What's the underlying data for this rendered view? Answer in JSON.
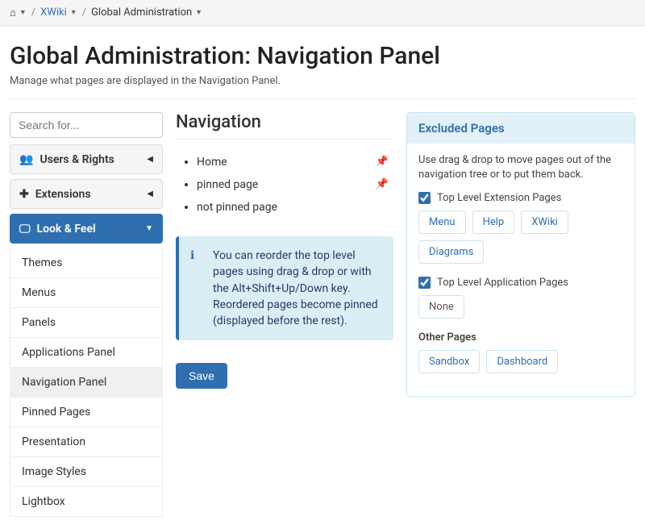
{
  "breadcrumb": {
    "xwiki": "XWiki",
    "current": "Global Administration"
  },
  "page": {
    "title": "Global Administration: Navigation Panel",
    "subtitle": "Manage what pages are displayed in the Navigation Panel."
  },
  "search": {
    "placeholder": "Search for..."
  },
  "menu": {
    "users_rights": "Users & Rights",
    "extensions": "Extensions",
    "look_feel": "Look & Feel",
    "look_feel_items": {
      "themes": "Themes",
      "menus": "Menus",
      "panels": "Panels",
      "applications_panel": "Applications Panel",
      "navigation_panel": "Navigation Panel",
      "pinned_pages": "Pinned Pages",
      "presentation": "Presentation",
      "image_styles": "Image Styles",
      "lightbox": "Lightbox"
    }
  },
  "navigation": {
    "title": "Navigation",
    "items": {
      "home": "Home",
      "pinned": "pinned page",
      "not_pinned": "not pinned page"
    },
    "info": "You can reorder the top level pages using drag & drop or with the Alt+Shift+Up/Down key. Reordered pages become pinned (displayed before the rest).",
    "save": "Save"
  },
  "excluded": {
    "title": "Excluded Pages",
    "desc": "Use drag & drop to move pages out of the navigation tree or to put them back.",
    "top_extension": "Top Level Extension Pages",
    "ext_chips": {
      "menu": "Menu",
      "help": "Help",
      "xwiki": "XWiki",
      "diagrams": "Diagrams"
    },
    "top_application": "Top Level Application Pages",
    "app_chips": {
      "none": "None"
    },
    "other_pages": "Other Pages",
    "other_chips": {
      "sandbox": "Sandbox",
      "dashboard": "Dashboard"
    }
  }
}
